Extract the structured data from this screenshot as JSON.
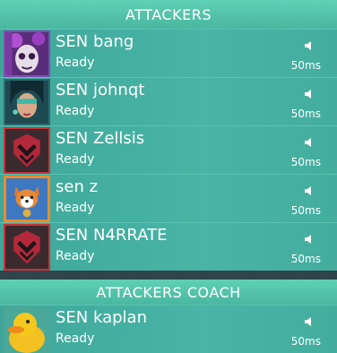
{
  "attackers": {
    "title": "ATTACKERS",
    "players": [
      {
        "name": "SEN bang",
        "status": "Ready",
        "ping": "50ms",
        "avatar": "skull-painted-agent-icon"
      },
      {
        "name": "SEN johnqt",
        "status": "Ready",
        "ping": "50ms",
        "avatar": "masked-agent-icon"
      },
      {
        "name": "SEN Zellsis",
        "status": "Ready",
        "ping": "50ms",
        "avatar": "red-emblem-icon"
      },
      {
        "name": "sen z",
        "status": "Ready",
        "ping": "50ms",
        "avatar": "corgi-icon"
      },
      {
        "name": "SEN N4RRATE",
        "status": "Ready",
        "ping": "50ms",
        "avatar": "red-emblem-icon"
      }
    ]
  },
  "coach": {
    "title": "ATTACKERS COACH",
    "players": [
      {
        "name": "SEN kaplan",
        "status": "Ready",
        "ping": "50ms",
        "avatar": "duck-icon"
      }
    ]
  },
  "colors": {
    "header": "#4ab7a0",
    "row": "#45b0a0",
    "background": "#2e4c52",
    "emblem_red": "#c8323c"
  }
}
